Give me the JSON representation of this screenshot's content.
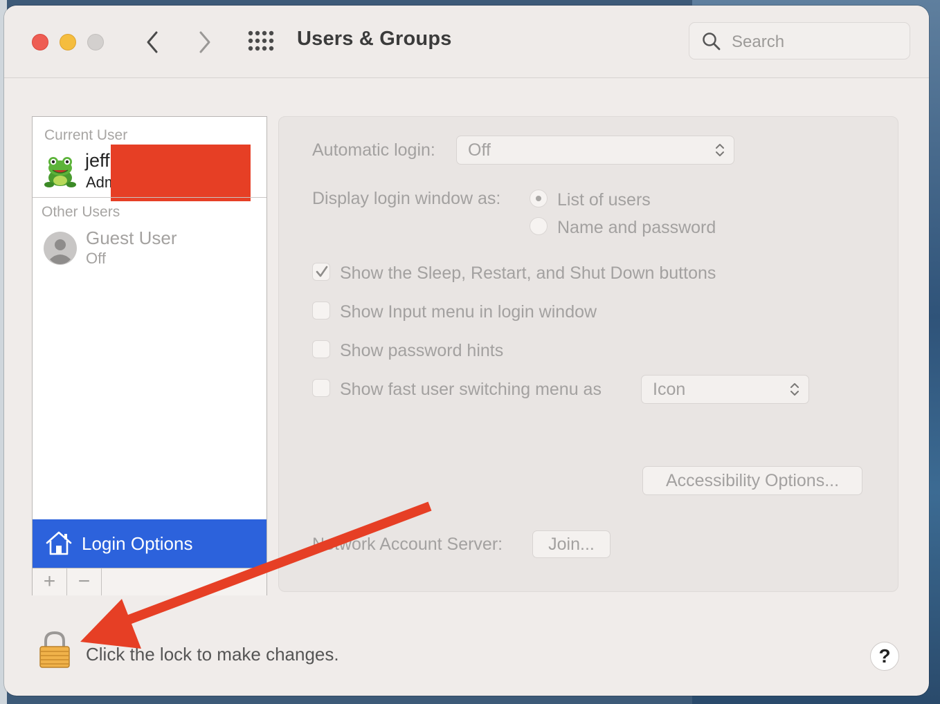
{
  "window": {
    "title": "Users & Groups",
    "search_placeholder": "Search"
  },
  "users": {
    "current_label": "Current User",
    "current_user": {
      "name": "jeff",
      "role": "Adm"
    },
    "other_label": "Other Users",
    "guest": {
      "name": "Guest User",
      "status": "Off"
    },
    "login_options_label": "Login Options",
    "add_label": "+",
    "remove_label": "−"
  },
  "login_options": {
    "automatic_login_label": "Automatic login:",
    "automatic_login_value": "Off",
    "display_as_label": "Display login window as:",
    "display_list": "List of users",
    "display_name_pw": "Name and password",
    "display_selected": "List of users",
    "show_sleep": {
      "label": "Show the Sleep, Restart, and Shut Down buttons",
      "checked": true
    },
    "show_input": {
      "label": "Show Input menu in login window",
      "checked": false
    },
    "show_hints": {
      "label": "Show password hints",
      "checked": false
    },
    "show_fast": {
      "label": "Show fast user switching menu as",
      "checked": false
    },
    "fast_value": "Icon",
    "accessibility_button": "Accessibility Options...",
    "network_label": "Network Account Server:",
    "join_button": "Join..."
  },
  "footer": {
    "lock_text": "Click the lock to make changes.",
    "help_label": "?"
  },
  "colors": {
    "selection": "#2c62dc",
    "annotation_arrow": "#e63f25",
    "redaction": "#e63f25"
  }
}
